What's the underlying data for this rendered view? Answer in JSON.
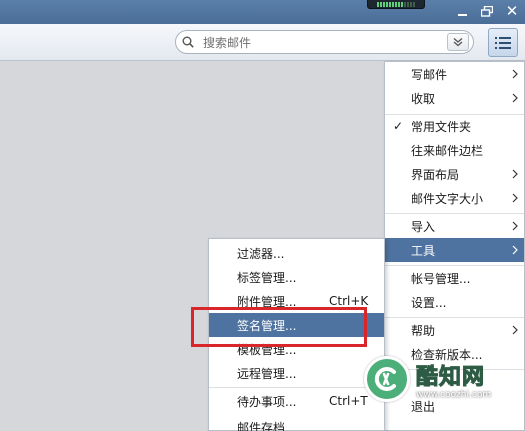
{
  "window": {
    "close_glyph": "✕"
  },
  "search": {
    "placeholder": "搜索邮件"
  },
  "main_menu": {
    "items": [
      {
        "label": "写邮件",
        "submenu": true
      },
      {
        "label": "收取",
        "submenu": true
      },
      {
        "label": "常用文件夹",
        "checked": true
      },
      {
        "label": "往来邮件边栏"
      },
      {
        "label": "界面布局",
        "submenu": true
      },
      {
        "label": "邮件文字大小",
        "submenu": true
      },
      {
        "label": "导入",
        "submenu": true
      },
      {
        "label": "工具",
        "submenu": true,
        "highlighted": true
      },
      {
        "label": "帐号管理..."
      },
      {
        "label": "设置..."
      },
      {
        "label": "帮助",
        "submenu": true
      },
      {
        "label": "检查新版本..."
      },
      {
        "label": "退出"
      }
    ],
    "check_glyph": "✓"
  },
  "tools_submenu": {
    "items": [
      {
        "label": "过滤器..."
      },
      {
        "label": "标签管理..."
      },
      {
        "label": "附件管理...",
        "shortcut": "Ctrl+K"
      },
      {
        "label": "签名管理...",
        "highlighted": true
      },
      {
        "label": "模板管理..."
      },
      {
        "label": "远程管理..."
      },
      {
        "label": "待办事项...",
        "shortcut": "Ctrl+T"
      },
      {
        "label": "邮件存档"
      }
    ]
  },
  "watermark": {
    "brand": "酷知网",
    "url": "www.coozhi.com"
  },
  "colors": {
    "titlebar": "#4a6e98",
    "highlight": "#4f73a0",
    "annotation_red": "#d9262b",
    "watermark_green": "#4caf7a"
  },
  "icons": [
    "search-icon",
    "chevron-down-double-icon",
    "hamburger-menu-icon",
    "minimize-icon",
    "restore-icon",
    "close-icon",
    "submenu-arrow-icon",
    "checkmark-icon",
    "coozhi-logo-icon"
  ]
}
